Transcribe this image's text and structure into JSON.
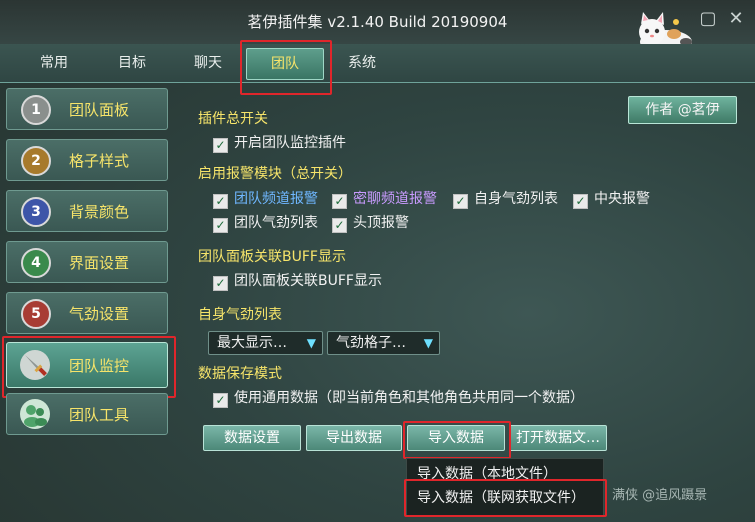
{
  "window": {
    "title": "茗伊插件集 v2.1.40 Build 20190904"
  },
  "tabs": [
    {
      "label": "常用"
    },
    {
      "label": "目标"
    },
    {
      "label": "聊天"
    },
    {
      "label": "团队"
    },
    {
      "label": "系统"
    }
  ],
  "author_button": "作者 @茗伊",
  "sidebar": {
    "items": [
      {
        "num": "1",
        "label": "团队面板"
      },
      {
        "num": "2",
        "label": "格子样式"
      },
      {
        "num": "3",
        "label": "背景颜色"
      },
      {
        "num": "4",
        "label": "界面设置"
      },
      {
        "num": "5",
        "label": "气劲设置"
      },
      {
        "label": "团队监控"
      },
      {
        "label": "团队工具"
      }
    ]
  },
  "sections": {
    "plugin_switch": {
      "title": "插件总开关",
      "enable_monitor": "开启团队监控插件"
    },
    "alert_modules": {
      "title": "启用报警模块（总开关）",
      "team_channel": "团队频道报警",
      "whisper_channel": "密聊频道报警",
      "self_buff_list": "自身气劲列表",
      "center_alert": "中央报警",
      "team_buff_list": "团队气劲列表",
      "head_alert": "头顶报警"
    },
    "panel_buff": {
      "title": "团队面板关联BUFF显示",
      "option": "团队面板关联BUFF显示"
    },
    "self_buff": {
      "title": "自身气劲列表",
      "dropdown_max": "最大显示…",
      "dropdown_grid": "气劲格子…"
    },
    "save_mode": {
      "title": "数据保存模式",
      "option": "使用通用数据（即当前角色和其他角色共用同一个数据）"
    }
  },
  "buttons": {
    "data_settings": "数据设置",
    "export_data": "导出数据",
    "import_data": "导入数据",
    "open_data_file": "打开数据文…"
  },
  "import_menu": {
    "local_file": "导入数据（本地文件）",
    "online_file": "导入数据（联网获取文件）"
  },
  "watermark": "满侠 @追风蹑景",
  "colors": {
    "accent": "#f6e46a",
    "highlight": "#e0262b"
  }
}
